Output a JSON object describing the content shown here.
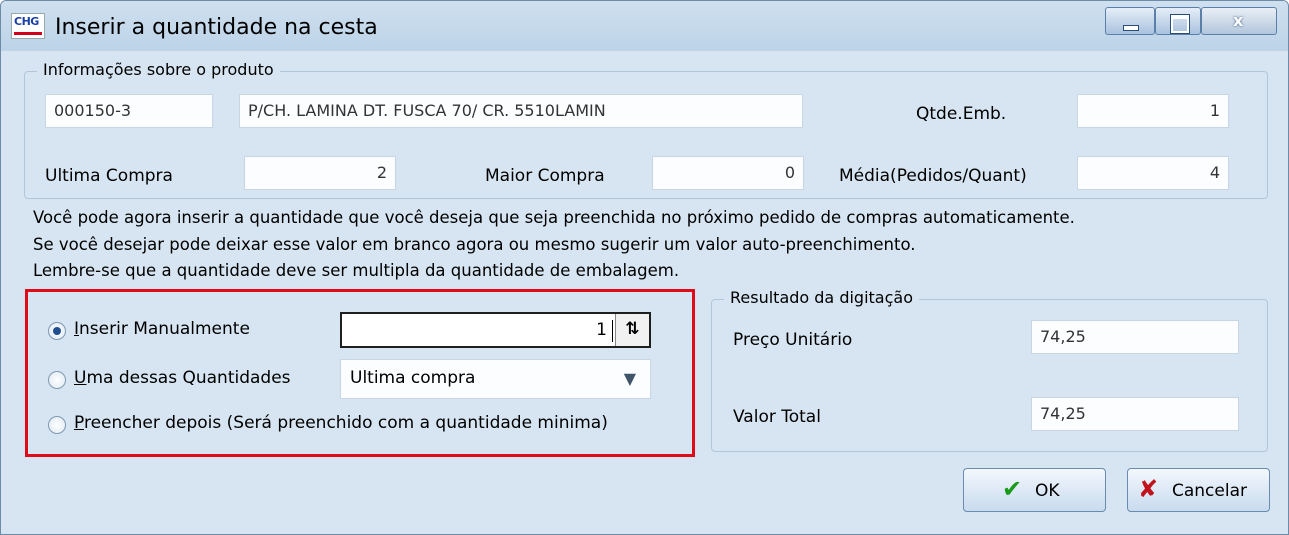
{
  "window": {
    "title": "Inserir a quantidade na cesta",
    "app_icon_text": "CHG"
  },
  "controls": {
    "minimize": "_",
    "close": "x"
  },
  "product_info": {
    "legend": "Informações sobre o produto",
    "code": "000150-3",
    "description": "P/CH. LAMINA DT. FUSCA 70/ CR. 5510LAMIN",
    "qtde_emb_label": "Qtde.Emb.",
    "qtde_emb_value": "1",
    "ultima_compra_label": "Ultima Compra",
    "ultima_compra_value": "2",
    "maior_compra_label": "Maior Compra",
    "maior_compra_value": "0",
    "media_label": "Média(Pedidos/Quant)",
    "media_value": "4"
  },
  "info_lines": [
    "Você pode agora inserir a quantidade que você deseja que seja preenchida no próximo pedido de compras automaticamente.",
    "Se você desejar pode deixar esse valor em branco agora ou mesmo sugerir um valor auto-preenchimento.",
    "Lembre-se que a quantidade deve ser multipla da quantidade de embalagem."
  ],
  "options": {
    "manual": {
      "first": "I",
      "rest": "nserir Manualmente",
      "checked": true
    },
    "one_of": {
      "first": "U",
      "rest": "ma dessas Quantidades",
      "checked": false
    },
    "later": {
      "first": "P",
      "rest": "reencher depois (Será preenchido com a quantidade minima)",
      "checked": false
    },
    "manual_value": "1",
    "spin_glyph": "⇅",
    "select_value": "Ultima compra",
    "select_arrow": "▼"
  },
  "result": {
    "legend": "Resultado da digitação",
    "preco_label": "Preço  Unitário",
    "preco_value": "74,25",
    "total_label": "Valor Total",
    "total_value": "74,25"
  },
  "buttons": {
    "ok_icon": "✔",
    "ok_label": "OK",
    "cancel_icon": "✘",
    "cancel_label": "Cancelar"
  },
  "colors": {
    "background": "#d6e5f1",
    "highlight": "#e00b19",
    "ok_icon": "#1a9a1a",
    "cancel_icon": "#c0141d"
  }
}
